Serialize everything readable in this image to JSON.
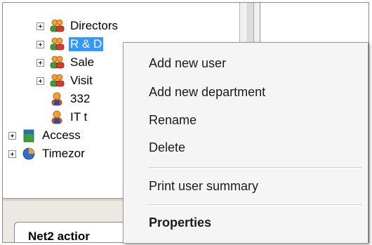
{
  "tree": {
    "items": [
      {
        "label": "Directors",
        "icon": "user-group-icon",
        "expander": true
      },
      {
        "label": "R & D",
        "icon": "user-group-icon",
        "expander": true,
        "selected": true
      },
      {
        "label": "Sale",
        "icon": "user-group-icon",
        "expander": true
      },
      {
        "label": "Visit",
        "icon": "user-group-icon",
        "expander": true
      },
      {
        "label": "332",
        "icon": "user-icon",
        "expander": false
      },
      {
        "label": "IT t",
        "icon": "user-icon",
        "expander": false
      },
      {
        "label": "Access",
        "icon": "access-level-icon",
        "expander": true
      },
      {
        "label": "Timezor",
        "icon": "timezone-icon",
        "expander": true
      }
    ]
  },
  "bottom_panel": {
    "tab_label": "Net2 actior"
  },
  "context_menu": {
    "add_new_user": "Add new user",
    "add_new_department": "Add new department",
    "rename": "Rename",
    "delete": "Delete",
    "print_user_summary": "Print user summary",
    "properties": "Properties"
  },
  "colors": {
    "selection": "#3399ff",
    "menu_background": "#f5f5f5"
  }
}
